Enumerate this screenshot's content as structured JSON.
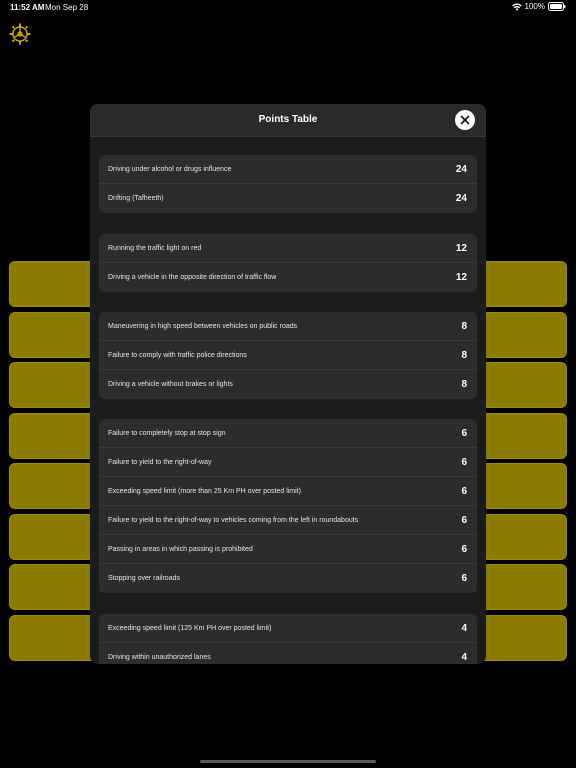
{
  "status_bar": {
    "time": "11:52 AM",
    "date": "Mon Sep 28",
    "battery": "100%"
  },
  "colors": {
    "accent_yellow": "#8b7a00",
    "gear": "#c9a900"
  },
  "icons": {
    "settings": "gear-icon",
    "close": "close-icon",
    "wifi": "wifi-icon",
    "battery": "battery-icon"
  },
  "modal": {
    "title": "Points Table",
    "groups": [
      {
        "rows": [
          {
            "label": "Driving under alcohol or drugs influence",
            "points": "24"
          },
          {
            "label": "Drifting (Tafheeth)",
            "points": "24"
          }
        ]
      },
      {
        "rows": [
          {
            "label": "Running the traffic light on red",
            "points": "12"
          },
          {
            "label": "Driving a vehicle in the opposite direction of traffic flow",
            "points": "12"
          }
        ]
      },
      {
        "rows": [
          {
            "label": "Maneuvering in high speed between vehicles on public roads",
            "points": "8"
          },
          {
            "label": "Failure to comply with traffic police directions",
            "points": "8"
          },
          {
            "label": "Driving a vehicle without brakes or lights",
            "points": "8"
          }
        ]
      },
      {
        "rows": [
          {
            "label": "Failure to completely stop at stop sign",
            "points": "6"
          },
          {
            "label": "Failure to yield to the right-of-way",
            "points": "6"
          },
          {
            "label": "Exceeding speed limit (more than 25 Km PH over posted limit)",
            "points": "6"
          },
          {
            "label": "Failure to yield to the right-of-way to vehicles coming from the left in roundabouts",
            "points": "6"
          },
          {
            "label": "Passing in areas in which passing is prohibited",
            "points": "6"
          },
          {
            "label": "Stopping over railroads",
            "points": "6"
          }
        ]
      },
      {
        "rows": [
          {
            "label": "Exceeding speed limit (125 Km PH over posted limit)",
            "points": "4"
          },
          {
            "label": "Driving within unauthorized lanes",
            "points": "4"
          }
        ]
      }
    ]
  }
}
